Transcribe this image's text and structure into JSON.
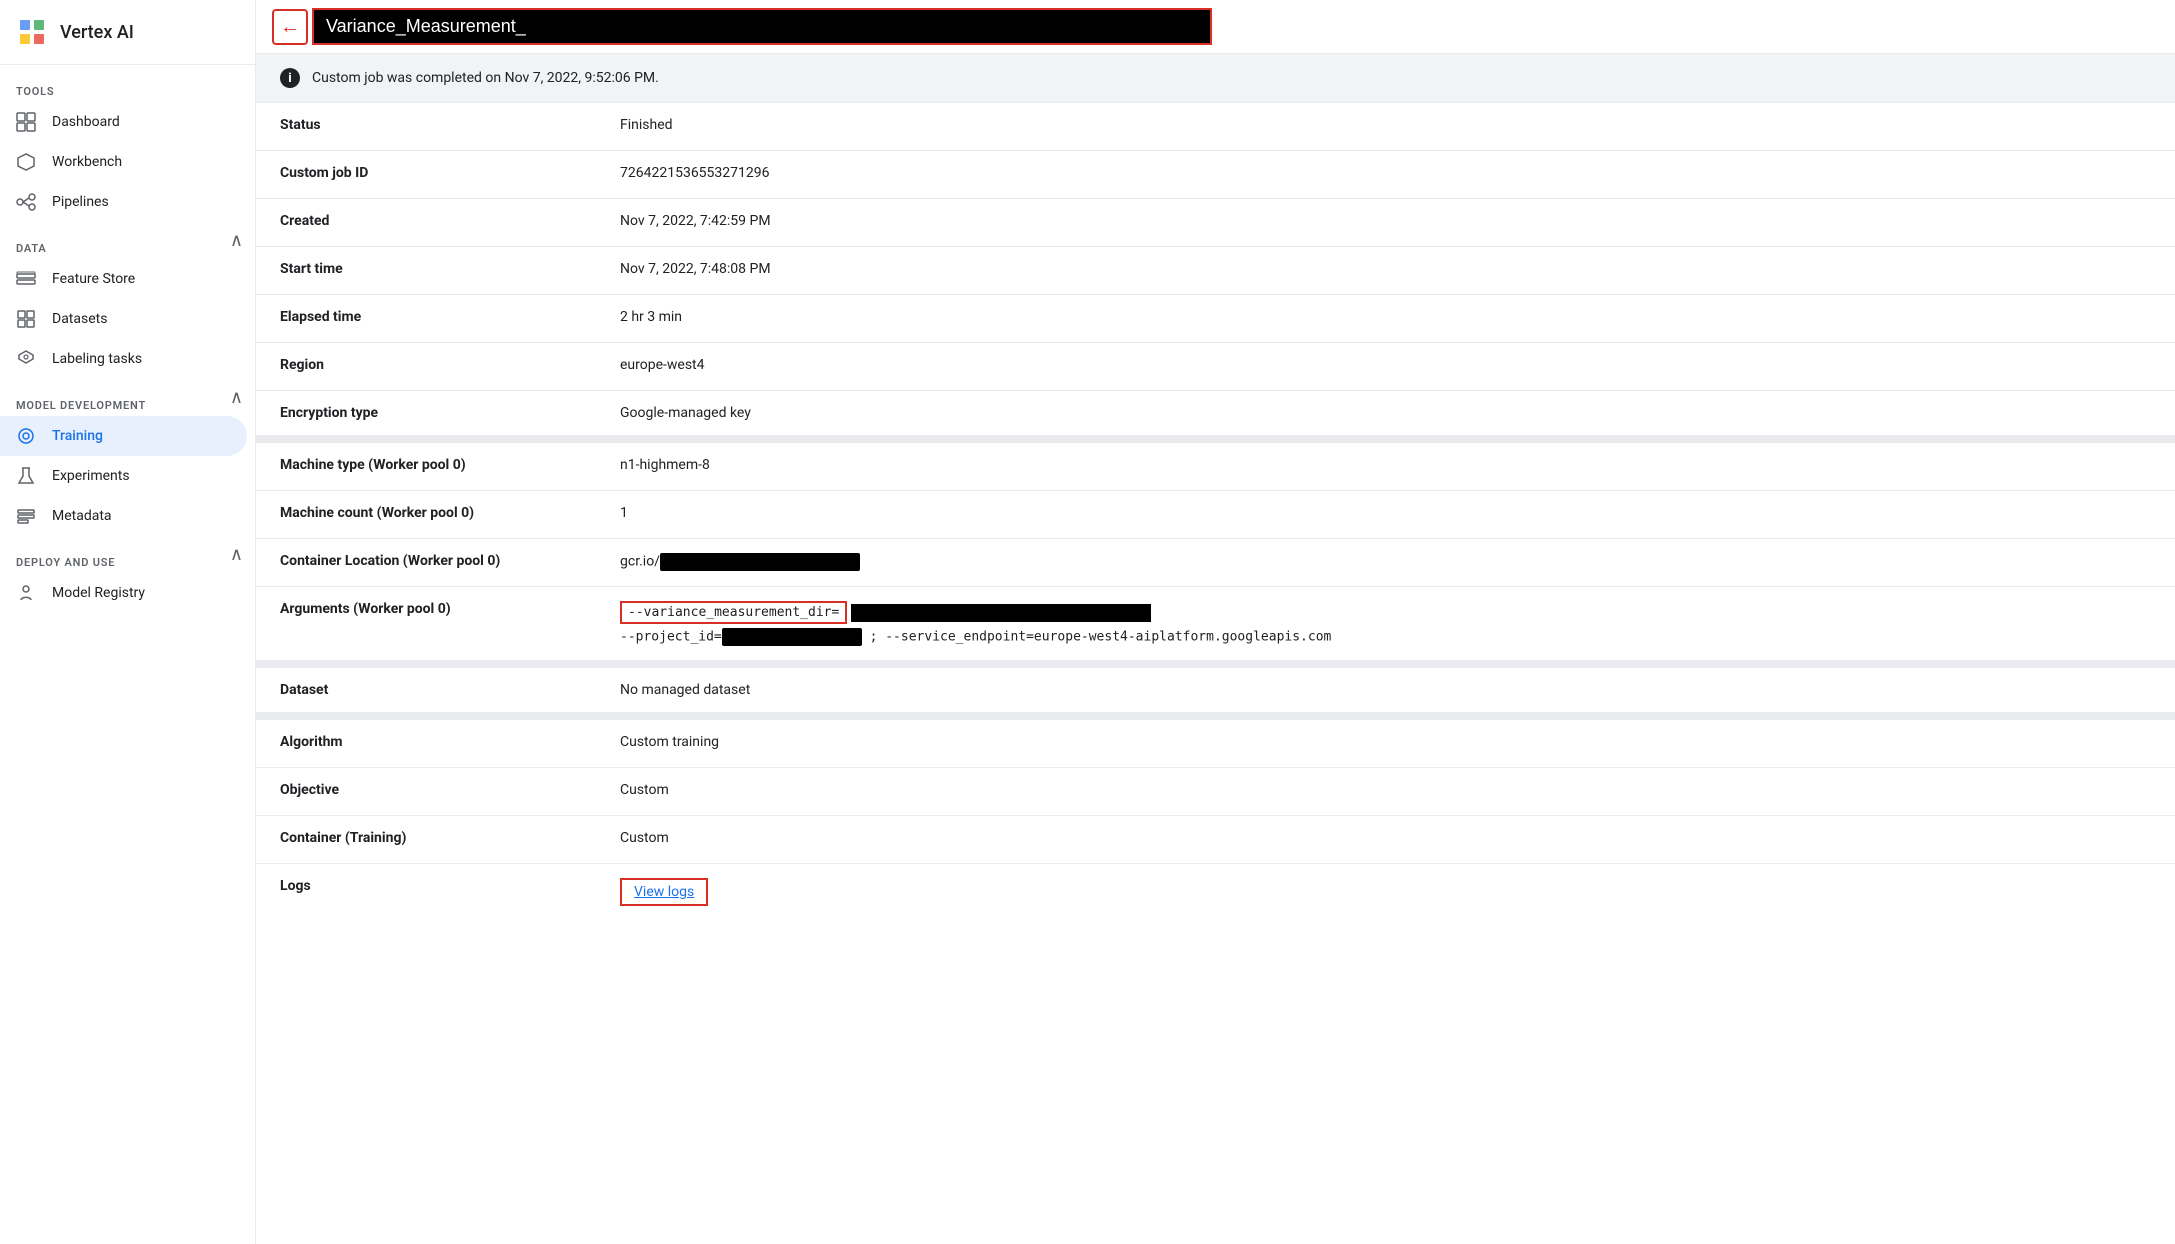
{
  "app": {
    "name": "Vertex AI",
    "logo_unicode": "⠿"
  },
  "sidebar": {
    "sections": [
      {
        "label": "TOOLS",
        "collapsible": false,
        "items": [
          {
            "id": "dashboard",
            "label": "Dashboard",
            "icon": "▦"
          },
          {
            "id": "workbench",
            "label": "Workbench",
            "icon": "⬡"
          },
          {
            "id": "pipelines",
            "label": "Pipelines",
            "icon": "⟳"
          }
        ]
      },
      {
        "label": "DATA",
        "collapsible": true,
        "expanded": true,
        "items": [
          {
            "id": "feature-store",
            "label": "Feature Store",
            "icon": "◫"
          },
          {
            "id": "datasets",
            "label": "Datasets",
            "icon": "⊞"
          },
          {
            "id": "labeling-tasks",
            "label": "Labeling tasks",
            "icon": "⬡"
          }
        ]
      },
      {
        "label": "MODEL DEVELOPMENT",
        "collapsible": true,
        "expanded": true,
        "items": [
          {
            "id": "training",
            "label": "Training",
            "icon": "◎",
            "active": true
          },
          {
            "id": "experiments",
            "label": "Experiments",
            "icon": "▲"
          },
          {
            "id": "metadata",
            "label": "Metadata",
            "icon": "⊟"
          }
        ]
      },
      {
        "label": "DEPLOY AND USE",
        "collapsible": true,
        "expanded": true,
        "items": [
          {
            "id": "model-registry",
            "label": "Model Registry",
            "icon": "💡"
          }
        ]
      }
    ]
  },
  "topbar": {
    "back_label": "←",
    "title": "Variance_Measurement_"
  },
  "banner": {
    "message": "Custom job was completed on Nov 7, 2022, 9:52:06 PM."
  },
  "details": {
    "rows": [
      {
        "label": "Status",
        "value": "Finished",
        "type": "text"
      },
      {
        "label": "Custom job ID",
        "value": "7264221536553271296",
        "type": "text"
      },
      {
        "label": "Created",
        "value": "Nov 7, 2022, 7:42:59 PM",
        "type": "text"
      },
      {
        "label": "Start time",
        "value": "Nov 7, 2022, 7:48:08 PM",
        "type": "text"
      },
      {
        "label": "Elapsed time",
        "value": "2 hr 3 min",
        "type": "text"
      },
      {
        "label": "Region",
        "value": "europe-west4",
        "type": "text"
      },
      {
        "label": "Encryption type",
        "value": "Google-managed key",
        "type": "text"
      }
    ],
    "worker_rows": [
      {
        "label": "Machine type (Worker pool 0)",
        "value": "n1-highmem-8",
        "type": "text"
      },
      {
        "label": "Machine count (Worker pool 0)",
        "value": "1",
        "type": "text"
      },
      {
        "label": "Container Location (Worker pool 0)",
        "value": "gcr.io/",
        "type": "container"
      },
      {
        "label": "Arguments (Worker pool 0)",
        "value": "--variance_measurement_dir=",
        "type": "args"
      }
    ],
    "dataset_rows": [
      {
        "label": "Dataset",
        "value": "No managed dataset",
        "type": "text"
      }
    ],
    "algo_rows": [
      {
        "label": "Algorithm",
        "value": "Custom training",
        "type": "text"
      },
      {
        "label": "Objective",
        "value": "Custom",
        "type": "text"
      },
      {
        "label": "Container (Training)",
        "value": "Custom",
        "type": "text"
      },
      {
        "label": "Logs",
        "value": "View logs",
        "type": "link"
      }
    ]
  }
}
